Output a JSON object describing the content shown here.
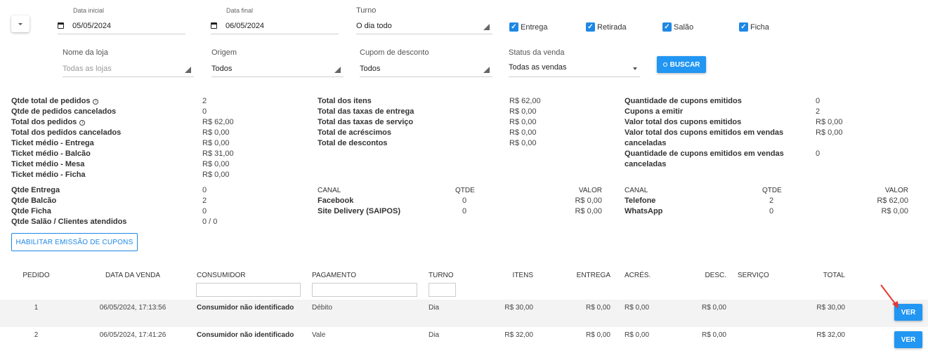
{
  "filters": {
    "data_inicial": {
      "label": "Data inicial",
      "value": "05/05/2024"
    },
    "data_final": {
      "label": "Data final",
      "value": "06/05/2024"
    },
    "turno": {
      "label": "Turno",
      "value": "O dia todo"
    },
    "checkboxes": [
      {
        "label": "Entrega",
        "checked": true
      },
      {
        "label": "Retirada",
        "checked": true
      },
      {
        "label": "Salão",
        "checked": true
      },
      {
        "label": "Ficha",
        "checked": true
      }
    ],
    "loja": {
      "label": "Nome da loja",
      "value": "Todas as lojas"
    },
    "origem": {
      "label": "Origem",
      "value": "Todos"
    },
    "cupom": {
      "label": "Cupom de desconto",
      "value": "Todos"
    },
    "status": {
      "label": "Status da venda",
      "value": "Todas as vendas"
    },
    "buscar_label": "BUSCAR"
  },
  "summary": {
    "col1": [
      {
        "label": "Qtde total de pedidos",
        "value": "2",
        "info": true
      },
      {
        "label": "Qtde de pedidos cancelados",
        "value": "0"
      },
      {
        "label": "Total dos pedidos",
        "value": "R$ 62,00",
        "info": true
      },
      {
        "label": "Total dos pedidos cancelados",
        "value": "R$ 0,00"
      },
      {
        "label": "Ticket médio - Entrega",
        "value": "R$ 0,00"
      },
      {
        "label": "Ticket médio - Balcão",
        "value": "R$ 31,00"
      },
      {
        "label": "Ticket médio - Mesa",
        "value": "R$ 0,00"
      },
      {
        "label": "Ticket médio - Ficha",
        "value": "R$ 0,00"
      }
    ],
    "col2": [
      {
        "label": "Total dos itens",
        "value": "R$ 62,00"
      },
      {
        "label": "Total das taxas de entrega",
        "value": "R$ 0,00"
      },
      {
        "label": "Total das taxas de serviço",
        "value": "R$ 0,00"
      },
      {
        "label": "Total de acréscimos",
        "value": "R$ 0,00"
      },
      {
        "label": "Total de descontos",
        "value": "R$ 0,00"
      }
    ],
    "col3": [
      {
        "label": "Quantidade de cupons emitidos",
        "value": "0"
      },
      {
        "label": "Cupons a emitir",
        "value": "2"
      },
      {
        "label": "Valor total dos cupons emitidos",
        "value": "R$ 0,00"
      },
      {
        "label": "Valor total dos cupons emitidos em vendas",
        "label2": "canceladas",
        "value": "R$ 0,00"
      },
      {
        "label": "Quantidade de cupons emitidos em vendas",
        "label2": "canceladas",
        "value": "0"
      }
    ],
    "qtde": [
      {
        "label": "Qtde Entrega",
        "value": "0"
      },
      {
        "label": "Qtde Balcão",
        "value": "2"
      },
      {
        "label": "Qtde Ficha",
        "value": "0"
      },
      {
        "label": "Qtde Salão / Clientes atendidos",
        "value": "0 / 0"
      }
    ],
    "canal_a": {
      "headers": [
        "CANAL",
        "QTDE",
        "VALOR"
      ],
      "rows": [
        {
          "canal": "Facebook",
          "qtde": "0",
          "valor": "R$ 0,00"
        },
        {
          "canal": "Site Delivery (SAIPOS)",
          "qtde": "0",
          "valor": "R$ 0,00"
        }
      ]
    },
    "canal_b": {
      "headers": [
        "CANAL",
        "QTDE",
        "VALOR"
      ],
      "rows": [
        {
          "canal": "Telefone",
          "qtde": "2",
          "valor": "R$ 62,00"
        },
        {
          "canal": "WhatsApp",
          "qtde": "0",
          "valor": "R$ 0,00"
        }
      ]
    },
    "cupons_button": "HABILITAR EMISSÃO DE CUPONS"
  },
  "table": {
    "headers": [
      "PEDIDO",
      "DATA DA VENDA",
      "CONSUMIDOR",
      "PAGAMENTO",
      "TURNO",
      "ITENS",
      "ENTREGA",
      "ACRÉS.",
      "DESC.",
      "SERVIÇO",
      "TOTAL"
    ],
    "rows": [
      {
        "pedido": "1",
        "data": "06/05/2024, 17:13:56",
        "consumidor": "Consumidor não identificado",
        "pagamento": "Débito",
        "turno": "Dia",
        "itens": "R$ 30,00",
        "entrega": "R$ 0,00",
        "acres": "R$ 0,00",
        "desc": "R$ 0,00",
        "servico": "",
        "total": "R$ 30,00",
        "ver": "VER"
      },
      {
        "pedido": "2",
        "data": "06/05/2024, 17:41:26",
        "consumidor": "Consumidor não identificado",
        "pagamento": "Vale",
        "turno": "Dia",
        "itens": "R$ 32,00",
        "entrega": "R$ 0,00",
        "acres": "R$ 0,00",
        "desc": "R$ 0,00",
        "servico": "",
        "total": "R$ 32,00",
        "ver": "VER"
      }
    ]
  },
  "colors": {
    "primary": "#2196f3",
    "annotation_arrow": "#e53935"
  }
}
